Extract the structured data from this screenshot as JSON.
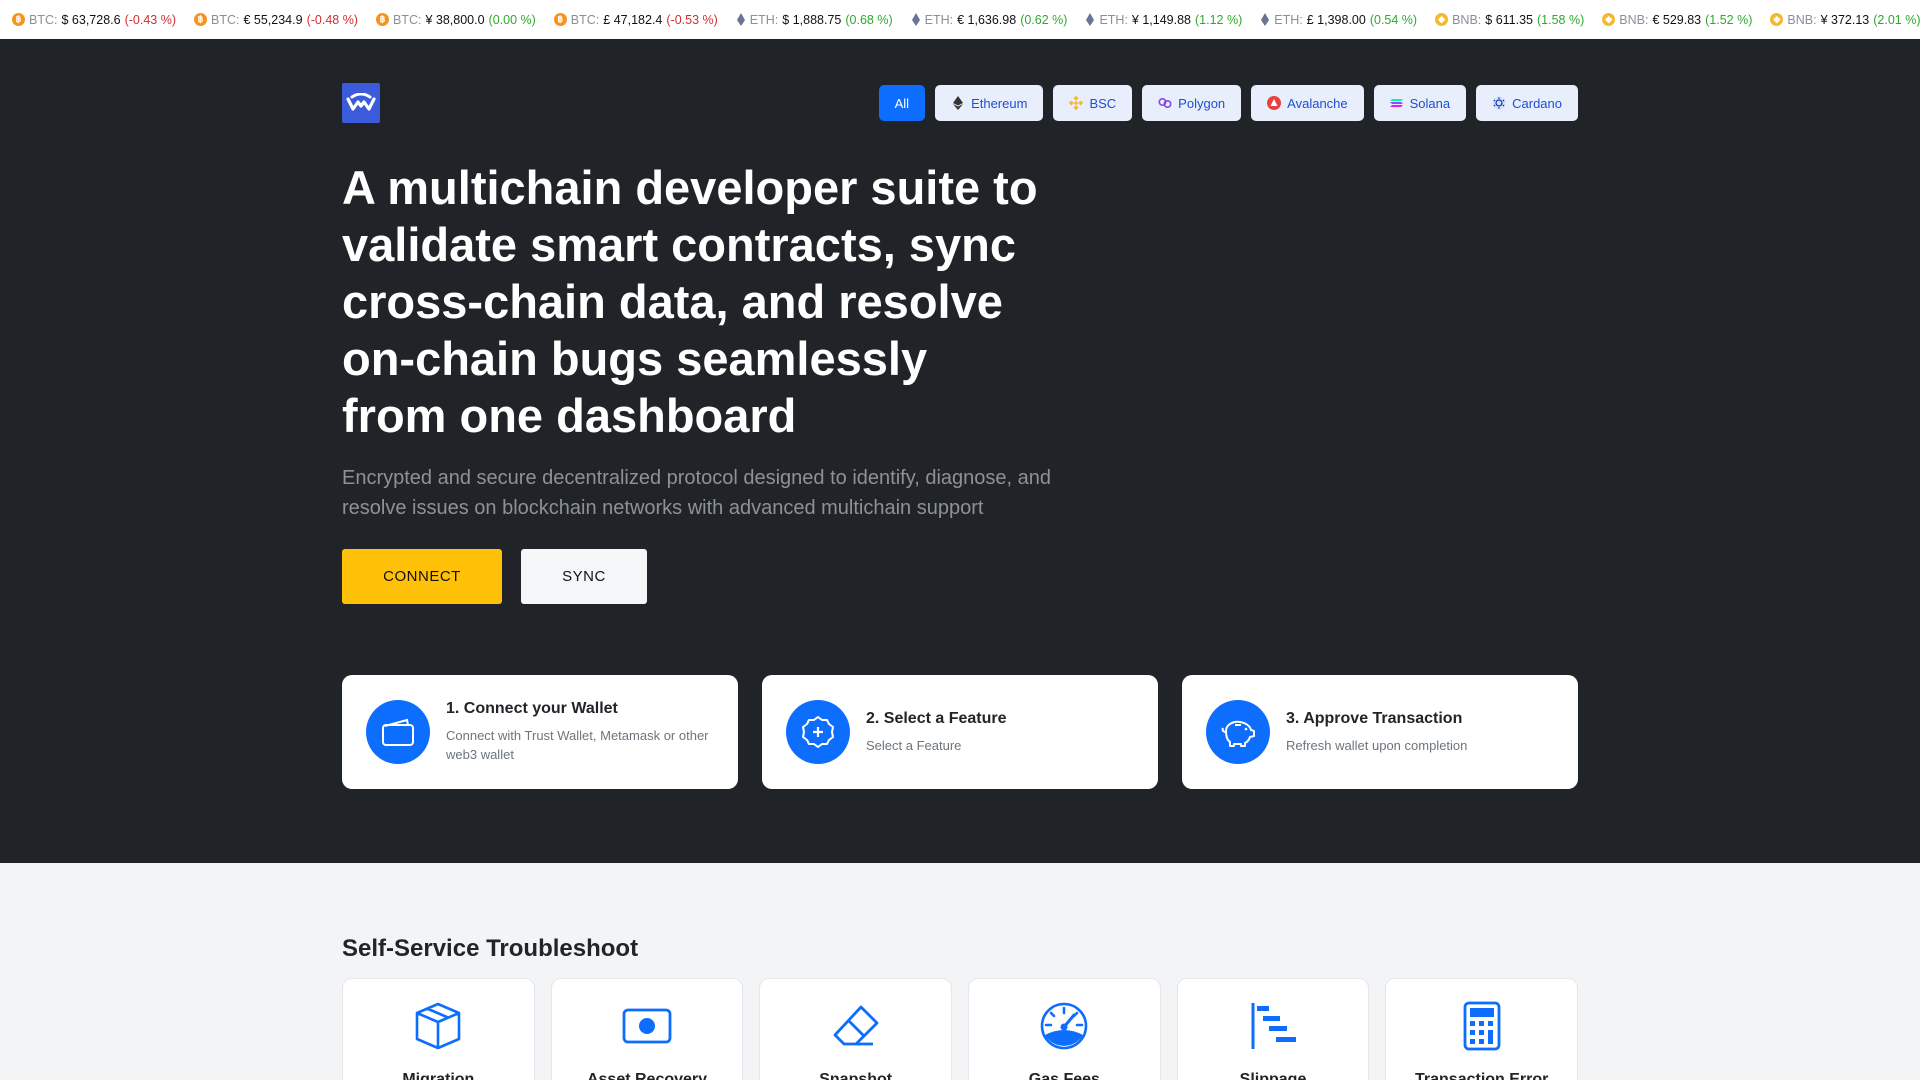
{
  "ticker": [
    {
      "coin": "btc",
      "sym": "BTC:",
      "price": "$ 63,728.6",
      "chg": "(-0.43 %)",
      "dir": "neg"
    },
    {
      "coin": "btc",
      "sym": "BTC:",
      "price": "€ 55,234.9",
      "chg": "(-0.48 %)",
      "dir": "neg"
    },
    {
      "coin": "btc",
      "sym": "BTC:",
      "price": "¥ 38,800.0",
      "chg": "(0.00 %)",
      "dir": "neu"
    },
    {
      "coin": "btc",
      "sym": "BTC:",
      "price": "£ 47,182.4",
      "chg": "(-0.53 %)",
      "dir": "neg"
    },
    {
      "coin": "eth",
      "sym": "ETH:",
      "price": "$ 1,888.75",
      "chg": "(0.68 %)",
      "dir": "pos"
    },
    {
      "coin": "eth",
      "sym": "ETH:",
      "price": "€ 1,636.98",
      "chg": "(0.62 %)",
      "dir": "pos"
    },
    {
      "coin": "eth",
      "sym": "ETH:",
      "price": "¥ 1,149.88",
      "chg": "(1.12 %)",
      "dir": "pos"
    },
    {
      "coin": "eth",
      "sym": "ETH:",
      "price": "£ 1,398.00",
      "chg": "(0.54 %)",
      "dir": "pos"
    },
    {
      "coin": "bnb",
      "sym": "BNB:",
      "price": "$ 611.35",
      "chg": "(1.58 %)",
      "dir": "pos"
    },
    {
      "coin": "bnb",
      "sym": "BNB:",
      "price": "€ 529.83",
      "chg": "(1.52 %)",
      "dir": "pos"
    },
    {
      "coin": "bnb",
      "sym": "BNB:",
      "price": "¥ 372.13",
      "chg": "(2.01 %)",
      "dir": "pos"
    }
  ],
  "chains": [
    {
      "label": "All",
      "icon": "",
      "active": true
    },
    {
      "label": "Ethereum",
      "icon": "ethereum-icon",
      "active": false
    },
    {
      "label": "BSC",
      "icon": "bsc-icon",
      "active": false
    },
    {
      "label": "Polygon",
      "icon": "polygon-icon",
      "active": false
    },
    {
      "label": "Avalanche",
      "icon": "avalanche-icon",
      "active": false
    },
    {
      "label": "Solana",
      "icon": "solana-icon",
      "active": false
    },
    {
      "label": "Cardano",
      "icon": "cardano-icon",
      "active": false
    }
  ],
  "hero": {
    "headline_lines": [
      "A multichain developer suite to",
      "validate smart contracts, sync",
      "cross-chain data, and resolve",
      "on-chain bugs seamlessly",
      "from one dashboard"
    ],
    "subtitle_lines": [
      "Encrypted and secure decentralized protocol designed to identify, diagnose, and",
      "resolve issues on blockchain networks with advanced multichain support"
    ],
    "connect_label": "CONNECT",
    "sync_label": "SYNC"
  },
  "steps": [
    {
      "title": "1. Connect your Wallet",
      "desc": "Connect with Trust Wallet, Metamask or other web3 wallet",
      "icon": "wallet-icon"
    },
    {
      "title": "2. Select a Feature",
      "desc": "Select a Feature",
      "icon": "plus-badge-icon"
    },
    {
      "title": "3. Approve Transaction",
      "desc": "Refresh wallet upon completion",
      "icon": "piggy-bank-icon"
    }
  ],
  "troubleshoot": {
    "title": "Self-Service Troubleshoot",
    "cards": [
      {
        "label": "Migration",
        "icon": "box-icon"
      },
      {
        "label": "Asset Recovery",
        "icon": "record-icon"
      },
      {
        "label": "Snapshot",
        "icon": "eraser-icon"
      },
      {
        "label": "Gas Fees",
        "icon": "speedometer-icon"
      },
      {
        "label": "Slippage",
        "icon": "bar-chart-steps-icon"
      },
      {
        "label": "Transaction Error",
        "icon": "calculator-icon"
      }
    ]
  },
  "colors": {
    "hero_bg": "#202327",
    "accent_blue": "#0d6efd",
    "connect_yellow": "#fec107"
  }
}
